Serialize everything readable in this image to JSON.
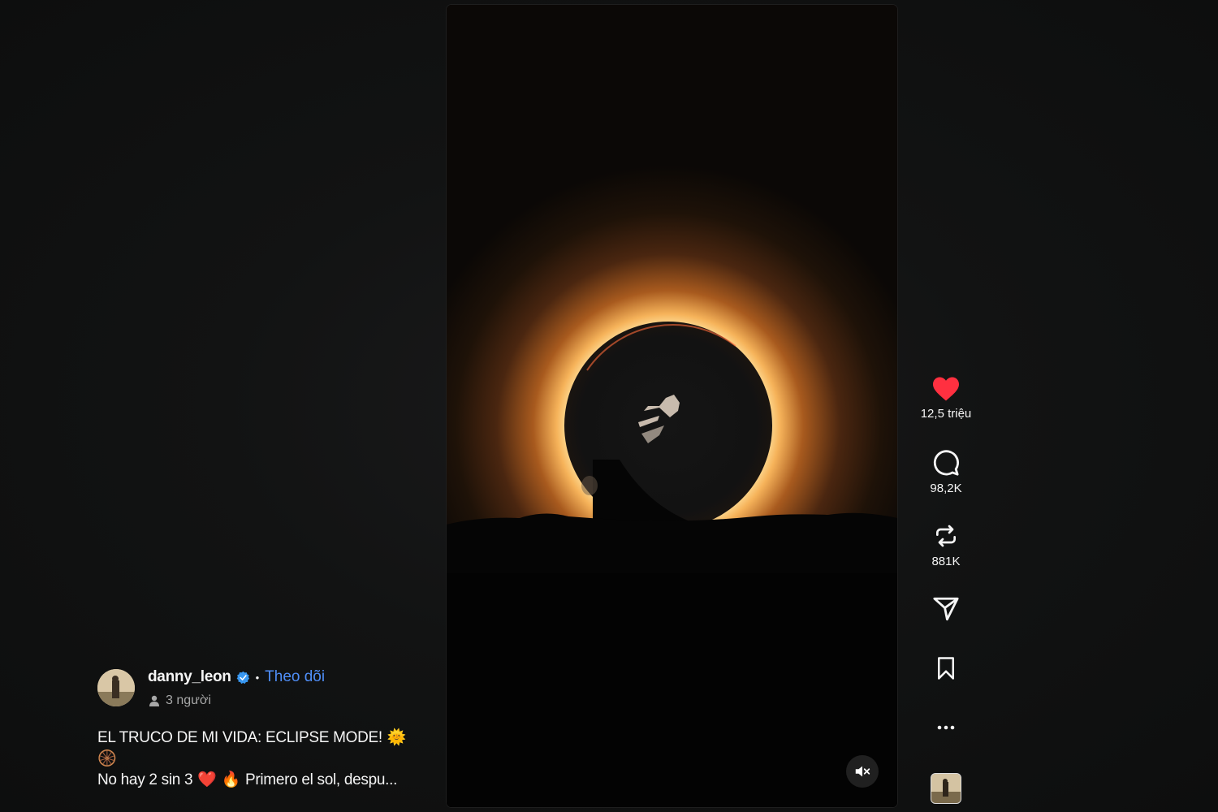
{
  "video": {
    "description_icon": "eclipse-skateboard-video",
    "mute_icon": "muted-speaker-icon"
  },
  "author": {
    "username": "danny_leon",
    "verified": true,
    "separator": "•",
    "follow_label": "Theo dõi",
    "audience_label": "3 người"
  },
  "caption": {
    "line1": "EL TRUCO DE MI VIDA: ECLIPSE MODE!",
    "line1_emoji": "🌞",
    "line2_emoji": "🛞",
    "line3_start": "No hay 2 sin 3",
    "line3_emoji_heart": "❤️",
    "line3_emoji_fire": "🔥",
    "line3_rest": "Primero el sol, despu..."
  },
  "actions": {
    "likes": "12,5 triệu",
    "comments": "98,2K",
    "reposts": "881K"
  },
  "colors": {
    "accent_blue": "#4f8ef7",
    "like_red": "#ff3040",
    "background": "#101111"
  }
}
